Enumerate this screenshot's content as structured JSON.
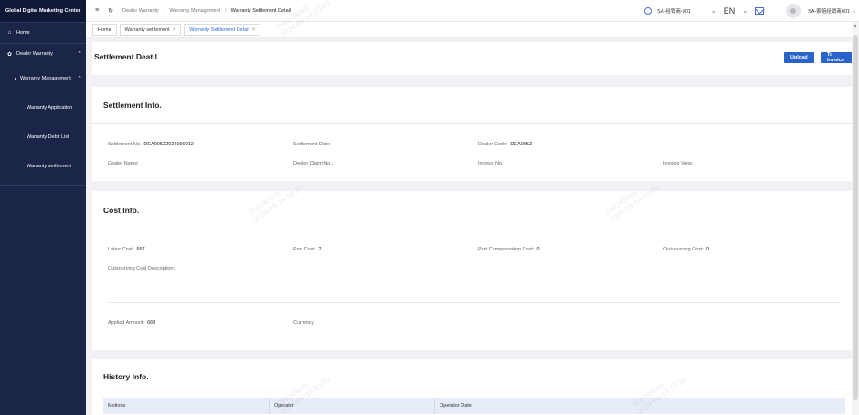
{
  "sidebar": {
    "title": "Global Digital Marketing Center",
    "items": [
      {
        "label": "Home"
      },
      {
        "label": "Dealer Warranty"
      },
      {
        "label": "Warranty Management"
      },
      {
        "label": "Warranty Application"
      },
      {
        "label": "Warranty Debit List"
      },
      {
        "label": "Warranty settlement"
      }
    ]
  },
  "topbar": {
    "breadcrumb": [
      "Dealer Warranty",
      "Warranty Management",
      "Warranty Settlement Detail"
    ],
    "role": "SA-经销商-001",
    "lang": "EN",
    "user": "SA-索赔经销商001"
  },
  "tabs": [
    {
      "label": "Home"
    },
    {
      "label": "Warranty settlement"
    },
    {
      "label": "Warranty Settlement Detail"
    }
  ],
  "page": {
    "title": "Settlement Deatil",
    "upload_label": "Upload",
    "invoice_label": "To Invoice"
  },
  "settlement": {
    "title": "Settlement Info.",
    "settlement_no_label": "Settlement No.",
    "settlement_no": "DEA005Z2024090012",
    "settlement_date_label": "Settlement Date:",
    "dealer_code_label": "Dealer Code:",
    "dealer_code": "DEA005Z",
    "dealer_name_label": "Dealer Name:",
    "dealer_claim_label": "Dealer Claim No.:",
    "invoice_no_label": "Invoice No.:",
    "invoice_view_label": "Invoice View:"
  },
  "cost": {
    "title": "Cost Info.",
    "labor_label": "Labor Cost:",
    "labor": "667",
    "part_label": "Part Cost:",
    "part": "2",
    "comp_label": "Part Compensation Cost:",
    "comp": "0",
    "outsourcing_label": "Outsourcing Cost:",
    "outsourcing": "0",
    "desc_label": "Outsourcing Cost Description:",
    "applied_label": "Applied Amount:",
    "applied": "669",
    "currency_label": "Currency:"
  },
  "history": {
    "title": "History Info.",
    "columns": [
      "Motions",
      "Operator",
      "Operator Date"
    ]
  },
  "watermark": "GW240045\n2024-09-14 10:20"
}
